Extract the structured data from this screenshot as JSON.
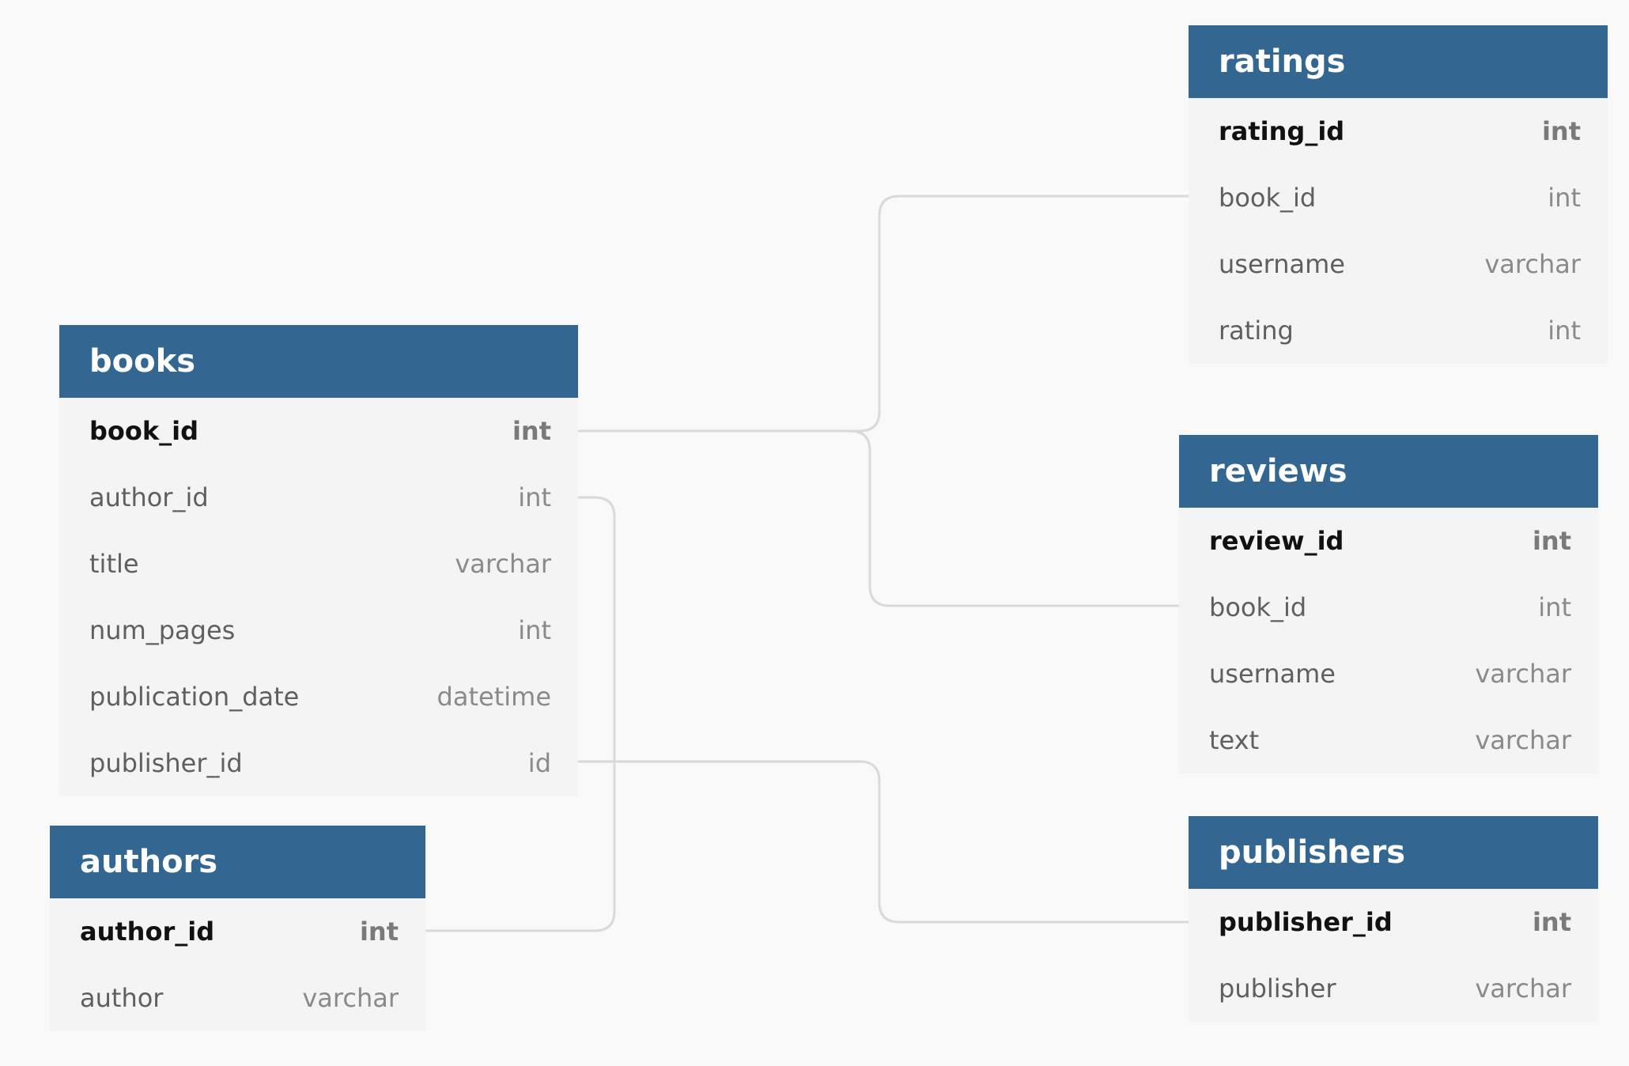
{
  "tables": {
    "ratings": {
      "name": "ratings",
      "fields": [
        {
          "name": "rating_id",
          "type": "int",
          "pk": true
        },
        {
          "name": "book_id",
          "type": "int"
        },
        {
          "name": "username",
          "type": "varchar"
        },
        {
          "name": "rating",
          "type": "int"
        }
      ]
    },
    "books": {
      "name": "books",
      "fields": [
        {
          "name": "book_id",
          "type": "int",
          "pk": true
        },
        {
          "name": "author_id",
          "type": "int"
        },
        {
          "name": "title",
          "type": "varchar"
        },
        {
          "name": "num_pages",
          "type": "int"
        },
        {
          "name": "publication_date",
          "type": "datetime"
        },
        {
          "name": "publisher_id",
          "type": "id"
        }
      ]
    },
    "reviews": {
      "name": "reviews",
      "fields": [
        {
          "name": "review_id",
          "type": "int",
          "pk": true
        },
        {
          "name": "book_id",
          "type": "int"
        },
        {
          "name": "username",
          "type": "varchar"
        },
        {
          "name": "text",
          "type": "varchar"
        }
      ]
    },
    "publishers": {
      "name": "publishers",
      "fields": [
        {
          "name": "publisher_id",
          "type": "int",
          "pk": true
        },
        {
          "name": "publisher",
          "type": "varchar"
        }
      ]
    },
    "authors": {
      "name": "authors",
      "fields": [
        {
          "name": "author_id",
          "type": "int",
          "pk": true
        },
        {
          "name": "author",
          "type": "varchar"
        }
      ]
    }
  },
  "relationships": [
    {
      "from": "books.book_id",
      "to": "ratings.book_id"
    },
    {
      "from": "books.book_id",
      "to": "reviews.book_id"
    },
    {
      "from": "books.author_id",
      "to": "authors.author_id"
    },
    {
      "from": "books.publisher_id",
      "to": "publishers.publisher_id"
    }
  ],
  "colors": {
    "header_background": "#336791",
    "header_text": "#ffffff",
    "table_background": "#f4f4f4",
    "canvas_background": "#f9f9f9",
    "connector": "#d9d9d9",
    "primary_key_text": "#111111",
    "field_text": "#5f5f5f",
    "type_text": "#8a8a8a"
  }
}
